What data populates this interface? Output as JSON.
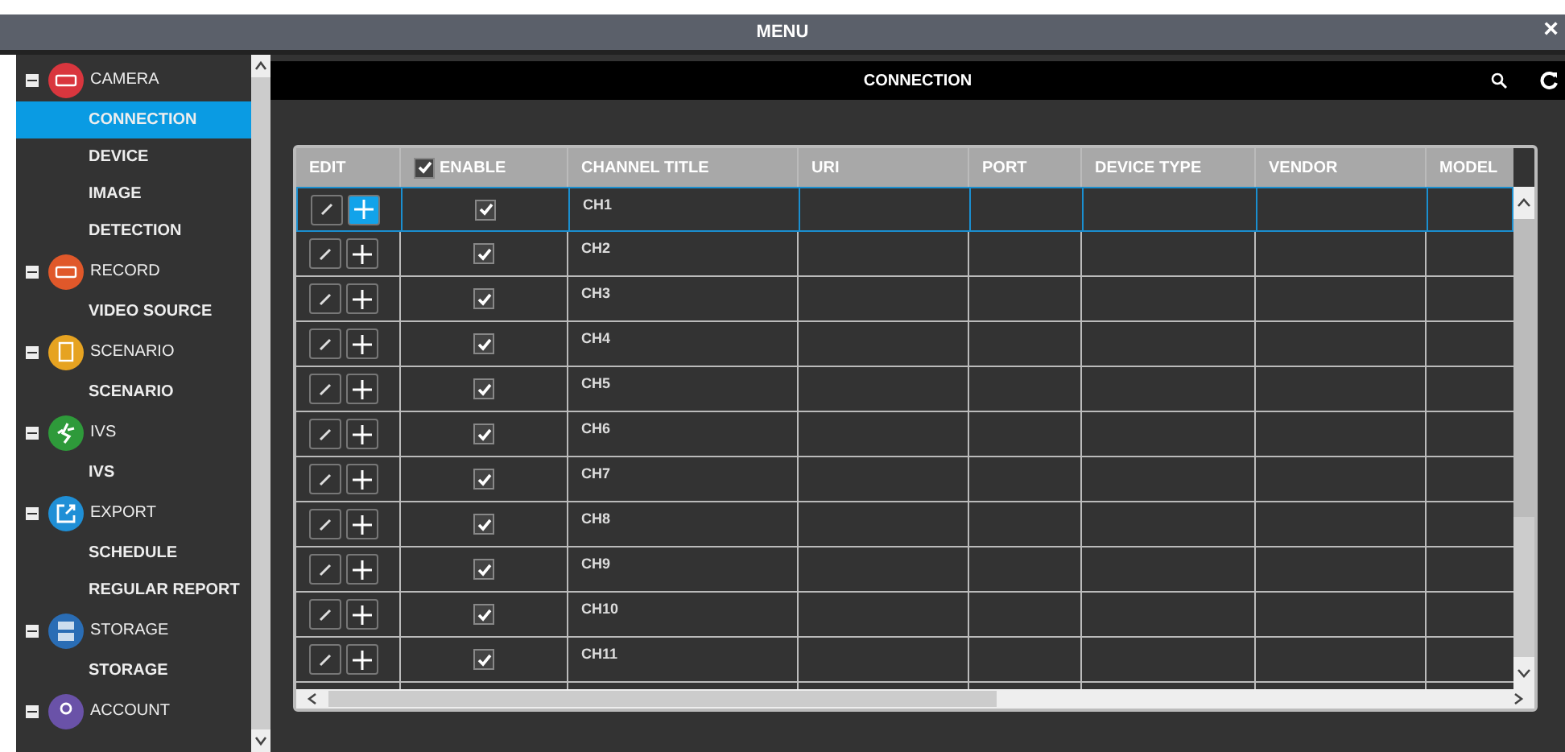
{
  "window": {
    "title": "MENU",
    "close": "×"
  },
  "sidebar": {
    "groups": [
      {
        "label": "CAMERA",
        "kind": "camera",
        "color": "#d9363e",
        "expanded": true,
        "children": [
          {
            "label": "CONNECTION",
            "selected": true
          },
          {
            "label": "DEVICE",
            "selected": false
          },
          {
            "label": "IMAGE",
            "selected": false
          },
          {
            "label": "DETECTION",
            "selected": false
          }
        ]
      },
      {
        "label": "RECORD",
        "kind": "record",
        "color": "#e0582a",
        "expanded": true,
        "children": [
          {
            "label": "VIDEO SOURCE",
            "selected": false
          }
        ]
      },
      {
        "label": "SCENARIO",
        "kind": "scenario",
        "color": "#e6a321",
        "expanded": true,
        "children": [
          {
            "label": "SCENARIO",
            "selected": false
          }
        ]
      },
      {
        "label": "IVS",
        "kind": "ivs",
        "color": "#2e9a3a",
        "expanded": true,
        "children": [
          {
            "label": "IVS",
            "selected": false
          }
        ]
      },
      {
        "label": "EXPORT",
        "kind": "export",
        "color": "#1f8fd6",
        "expanded": true,
        "children": [
          {
            "label": "SCHEDULE",
            "selected": false
          },
          {
            "label": "REGULAR REPORT",
            "selected": false
          }
        ]
      },
      {
        "label": "STORAGE",
        "kind": "storage",
        "color": "#2a6db5",
        "expanded": true,
        "children": [
          {
            "label": "STORAGE",
            "selected": false
          }
        ]
      },
      {
        "label": "ACCOUNT",
        "kind": "account",
        "color": "#6a52a8",
        "expanded": true
      }
    ]
  },
  "page": {
    "title": "CONNECTION"
  },
  "table": {
    "columns": [
      "EDIT",
      "ENABLE",
      "CHANNEL TITLE",
      "URI",
      "PORT",
      "DEVICE TYPE",
      "VENDOR",
      "MODEL"
    ],
    "enable_all": true,
    "rows": [
      {
        "channel_title": "CH1",
        "enabled": true,
        "selected": true
      },
      {
        "channel_title": "CH2",
        "enabled": true,
        "selected": false
      },
      {
        "channel_title": "CH3",
        "enabled": true,
        "selected": false
      },
      {
        "channel_title": "CH4",
        "enabled": true,
        "selected": false
      },
      {
        "channel_title": "CH5",
        "enabled": true,
        "selected": false
      },
      {
        "channel_title": "CH6",
        "enabled": true,
        "selected": false
      },
      {
        "channel_title": "CH7",
        "enabled": true,
        "selected": false
      },
      {
        "channel_title": "CH8",
        "enabled": true,
        "selected": false
      },
      {
        "channel_title": "CH9",
        "enabled": true,
        "selected": false
      },
      {
        "channel_title": "CH10",
        "enabled": true,
        "selected": false
      },
      {
        "channel_title": "CH11",
        "enabled": true,
        "selected": false
      }
    ]
  }
}
